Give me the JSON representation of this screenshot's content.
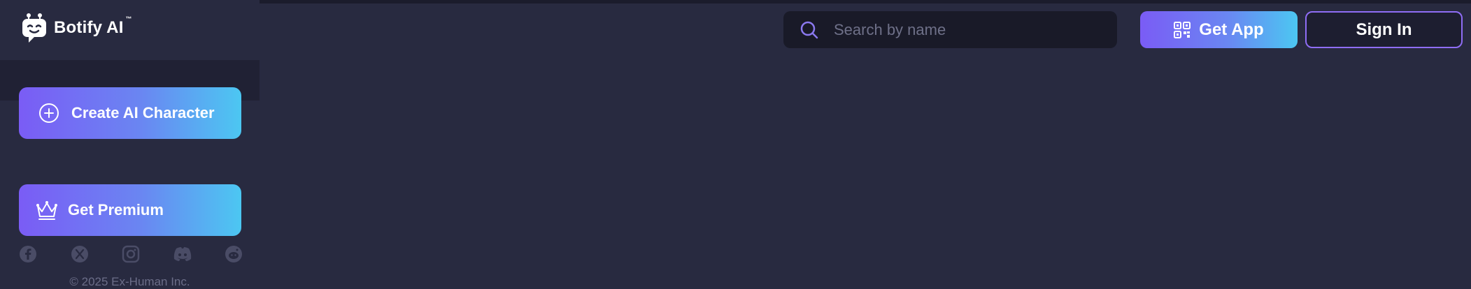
{
  "brand": {
    "name": "Botify AI",
    "trademark": "™",
    "logo_icon": "robot-face-logo"
  },
  "sidebar": {
    "create_button": {
      "label": "Create AI Character",
      "icon": "plus-circle-icon"
    },
    "premium_button": {
      "label": "Get Premium",
      "icon": "crown-icon"
    },
    "socials": [
      "facebook-icon",
      "x-twitter-icon",
      "instagram-icon",
      "discord-icon",
      "reddit-icon"
    ],
    "copyright": "© 2025 Ex-Human Inc."
  },
  "header": {
    "search": {
      "placeholder": "Search by name",
      "value": "",
      "icon": "search-icon"
    },
    "get_app": {
      "label": "Get App",
      "icon": "qr-code-icon"
    },
    "sign_in": {
      "label": "Sign In"
    }
  },
  "colors": {
    "background": "#282a40",
    "gradient_start": "#7a5cf5",
    "gradient_end": "#4cc7f2",
    "search_bg": "#191a28",
    "signin_border": "#8f6df5"
  }
}
